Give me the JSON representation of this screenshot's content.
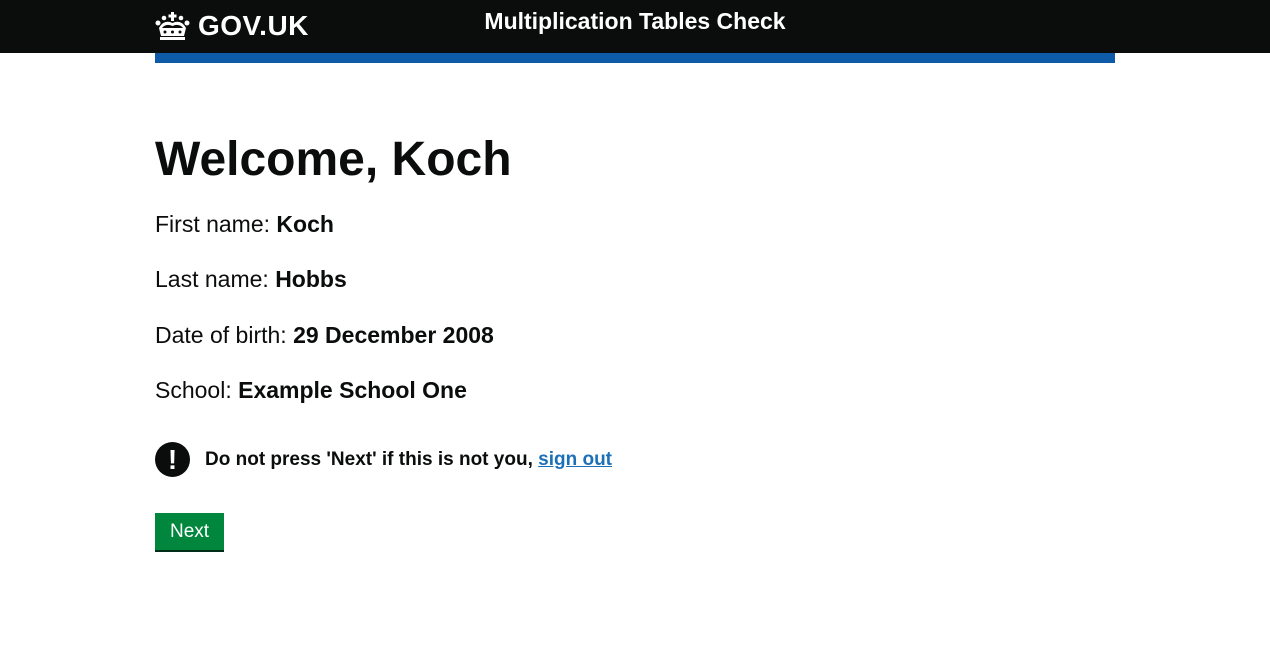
{
  "header": {
    "logo_text": "GOV.UK",
    "service_name": "Multiplication Tables Check"
  },
  "main": {
    "heading": "Welcome, Koch",
    "details": [
      {
        "label": "First name:",
        "value": "Koch"
      },
      {
        "label": "Last name:",
        "value": "Hobbs"
      },
      {
        "label": "Date of birth:",
        "value": "29 December 2008"
      },
      {
        "label": "School:",
        "value": "Example School One"
      }
    ],
    "warning": {
      "icon": "!",
      "text": "Do not press 'Next' if this is not you,",
      "link_text": "sign out"
    },
    "next_label": "Next"
  },
  "colors": {
    "header_bg": "#0b0c0c",
    "blue_bar": "#0d5aa7",
    "button_green": "#00873d",
    "link_blue": "#1d70b8"
  },
  "icons": {
    "logo": "crown-icon",
    "warning": "exclamation-icon"
  }
}
